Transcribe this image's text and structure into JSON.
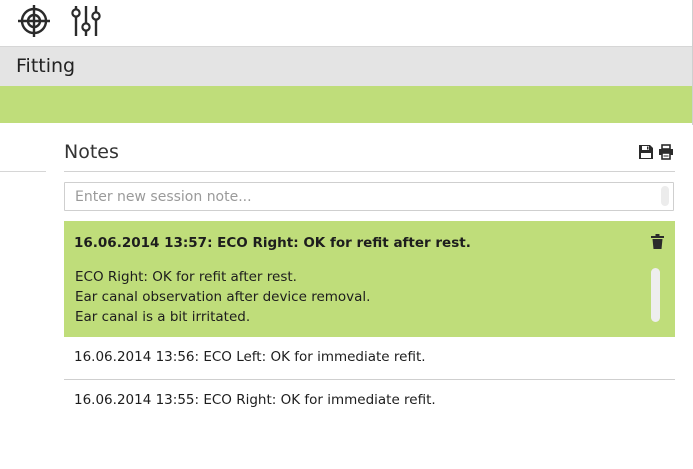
{
  "toolbar": {
    "icons": [
      "crosshair-icon",
      "sliders-icon"
    ]
  },
  "header": {
    "title": "Fitting"
  },
  "notes": {
    "title": "Notes",
    "actions": [
      "save-icon",
      "print-icon"
    ],
    "input": {
      "placeholder": "Enter new session note...",
      "value": ""
    },
    "items": [
      {
        "heading": "16.06.2014 13:57: ECO Right: OK for refit after rest.",
        "expanded": true,
        "body": [
          "ECO Right: OK for refit after rest.",
          "Ear canal observation after device removal.",
          "Ear canal is a bit irritated."
        ]
      },
      {
        "heading": "16.06.2014 13:56: ECO Left: OK for immediate refit.",
        "expanded": false
      },
      {
        "heading": "16.06.2014 13:55: ECO Right: OK for immediate refit.",
        "expanded": false
      }
    ]
  },
  "colors": {
    "accent_green": "#bfdd7a",
    "header_gray": "#e4e4e4",
    "icon_dark": "#2b2b2b"
  }
}
